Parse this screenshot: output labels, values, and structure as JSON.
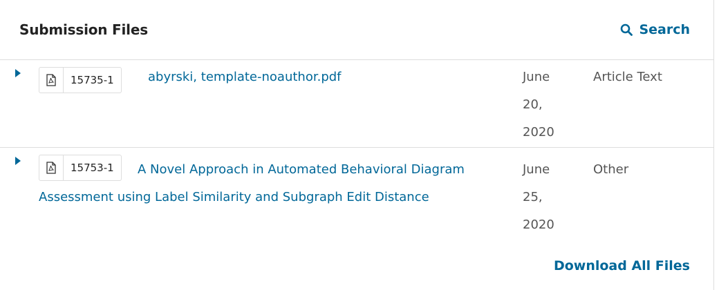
{
  "header": {
    "title": "Submission Files",
    "search_label": "Search"
  },
  "files": [
    {
      "id": "15735-1",
      "name": "abyrski, template-noauthor.pdf",
      "date_line1": "June",
      "date_line2": "20,",
      "date_line3": "2020",
      "genre": "Article Text"
    },
    {
      "id": "15753-1",
      "name_line1": "A Novel Approach in Automated Behavioral Diagram",
      "name_line2": "Assessment using Label Similarity and Subgraph Edit Distance",
      "date_line1": "June",
      "date_line2": "25,",
      "date_line3": "2020",
      "genre": "Other"
    }
  ],
  "footer": {
    "download_all_label": "Download All Files"
  },
  "colors": {
    "accent": "#006798",
    "border": "#dddddd",
    "muted_text": "#555555"
  },
  "icons": {
    "search": "search-icon",
    "file": "pdf-file-icon",
    "toggle": "expand-triangle-icon"
  }
}
